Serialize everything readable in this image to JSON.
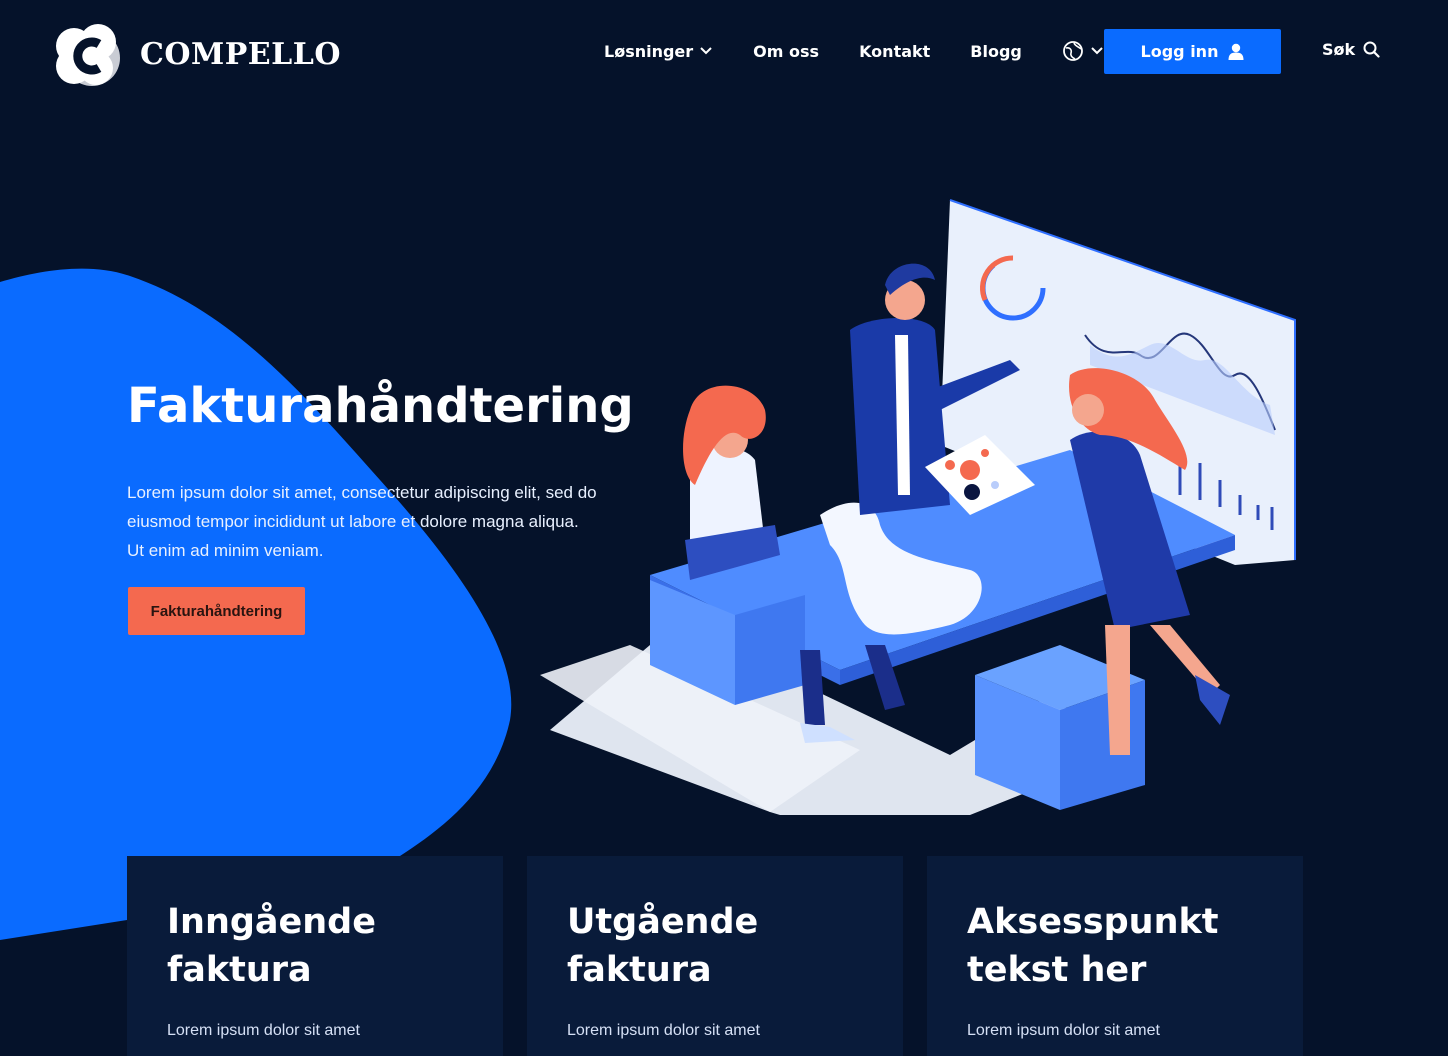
{
  "brand": {
    "name": "COMPELLO"
  },
  "nav": {
    "items": [
      {
        "label": "Løsninger",
        "has_dropdown": true
      },
      {
        "label": "Om oss"
      },
      {
        "label": "Kontakt"
      },
      {
        "label": "Blogg"
      }
    ],
    "language_icon": "globe-icon",
    "login_label": "Logg inn",
    "login_icon": "user-icon",
    "search_label": "Søk",
    "search_icon": "search-icon"
  },
  "hero": {
    "title": "Fakturahåndtering",
    "text": "Lorem ipsum dolor sit amet, consectetur adipiscing elit, sed do eiusmod tempor incididunt ut labore et dolore magna aliqua. Ut enim ad minim veniam.",
    "cta_label": "Fakturahåndtering"
  },
  "cards": [
    {
      "title": "Inngående faktura",
      "text": "Lorem ipsum dolor sit amet"
    },
    {
      "title": "Utgående faktura",
      "text": "Lorem ipsum dolor sit amet"
    },
    {
      "title": "Aksesspunkt tekst her",
      "text": "Lorem ipsum dolor sit amet"
    }
  ],
  "colors": {
    "background": "#05122a",
    "accent_blue": "#0a6bff",
    "cta_coral": "#f4694f",
    "card_bg": "#091b3a"
  }
}
